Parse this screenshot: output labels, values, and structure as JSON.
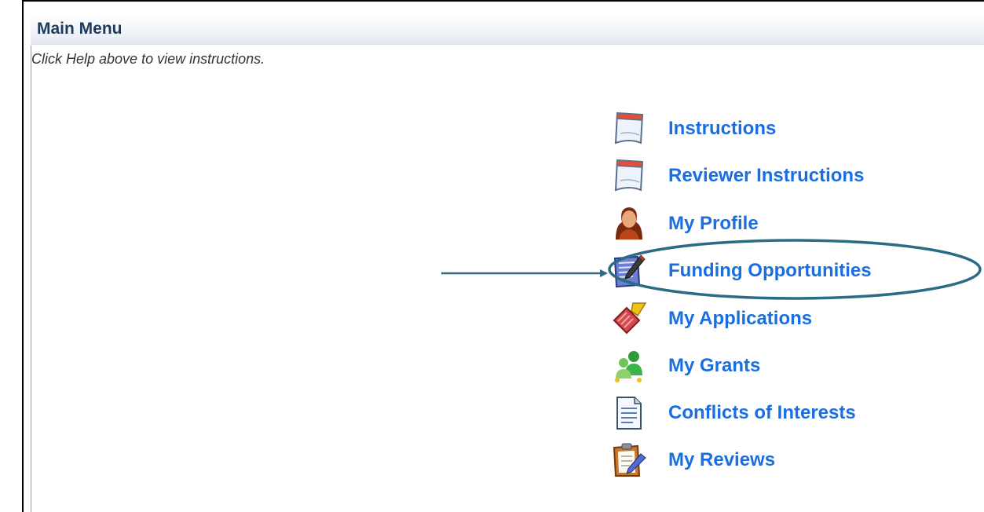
{
  "header": {
    "title": "Main Menu",
    "help_text": "Click Help above to view instructions."
  },
  "menu": {
    "items": [
      {
        "label": "Instructions",
        "icon": "calendar-page-icon"
      },
      {
        "label": "Reviewer Instructions",
        "icon": "calendar-page-icon"
      },
      {
        "label": "My Profile",
        "icon": "person-icon"
      },
      {
        "label": "Funding Opportunities",
        "icon": "notepad-pencil-icon"
      },
      {
        "label": "My Applications",
        "icon": "eraser-broom-icon"
      },
      {
        "label": "My Grants",
        "icon": "users-group-icon"
      },
      {
        "label": "Conflicts of Interests",
        "icon": "document-icon"
      },
      {
        "label": "My Reviews",
        "icon": "clipboard-pencil-icon"
      }
    ]
  },
  "annotation": {
    "highlighted_item": "Funding Opportunities",
    "color": "#2a6b86"
  },
  "colors": {
    "link": "#1a6ee0",
    "header_text": "#1f3a5a",
    "frame_border": "#000000"
  }
}
